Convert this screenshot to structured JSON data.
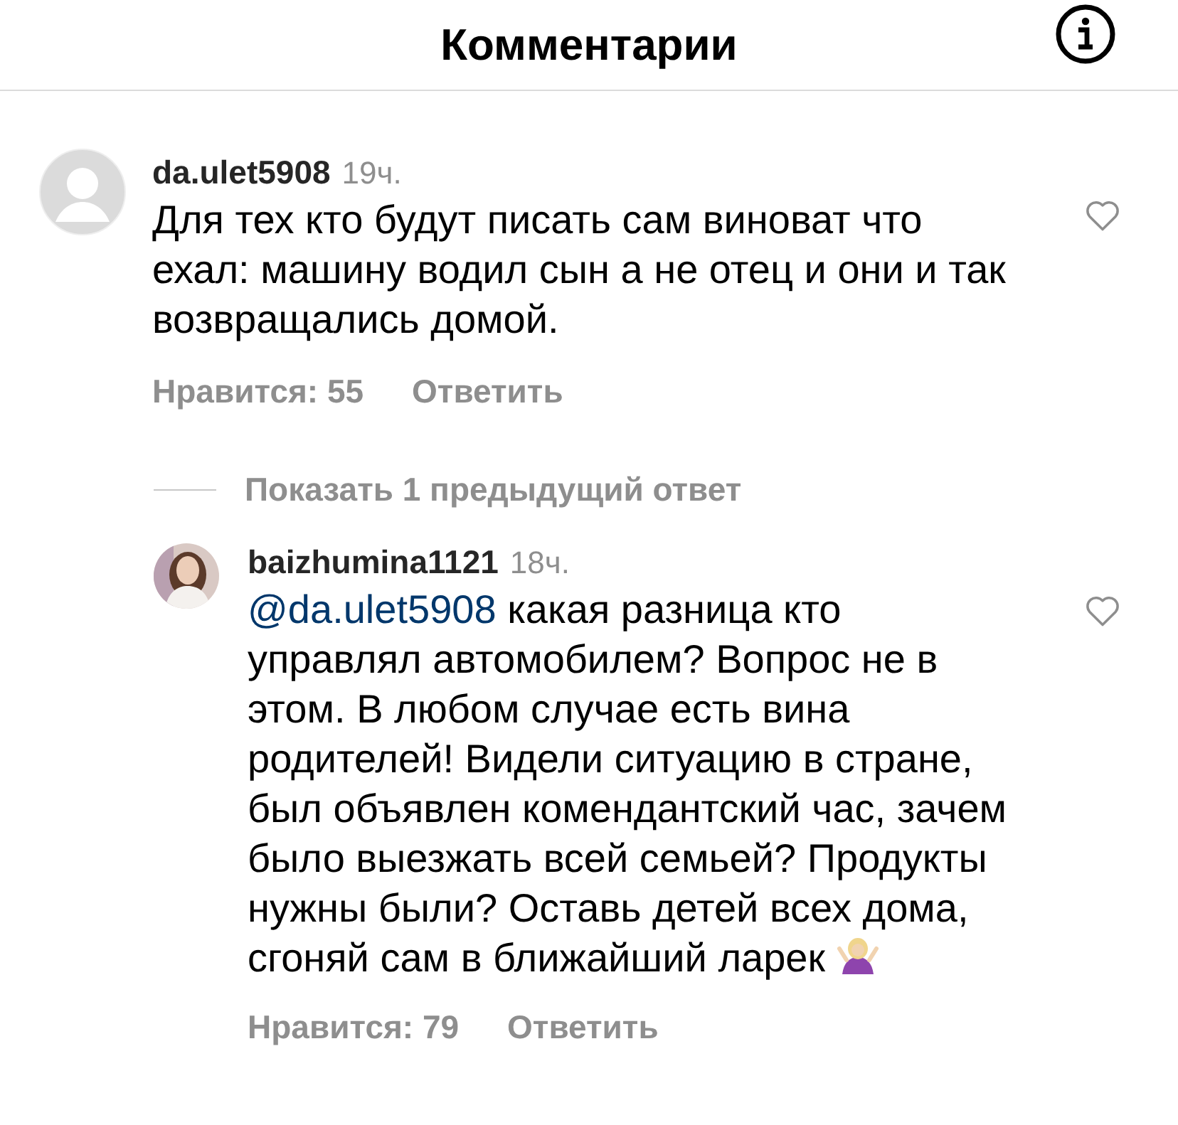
{
  "header": {
    "title": "Комментарии"
  },
  "comments": [
    {
      "username": "da.ulet5908",
      "time": "19ч.",
      "text": "Для тех кто будут писать сам виноват что ехал: машину водил сын а не отец и они и так возвращались домой.",
      "likes": "Нравится: 55",
      "reply": "Ответить",
      "liked": false,
      "avatar": {
        "kind": "placeholder"
      }
    }
  ],
  "show_replies": "Показать 1 предыдущий ответ",
  "replies": [
    {
      "username": "baizhumina1121",
      "time": "18ч.",
      "mention": "@da.ulet5908",
      "text": "какая разница кто управлял автомобилем? Вопрос не в этом. В любом случае есть вина родителей! Видели ситуацию в стране, был объявлен комендантский час, зачем было выезжать всей семьей? Продукты нужны были? Оставь детей всех дома, сгоняй сам в ближайший ларек",
      "likes": "Нравится: 79",
      "reply": "Ответить",
      "liked": false
    }
  ]
}
